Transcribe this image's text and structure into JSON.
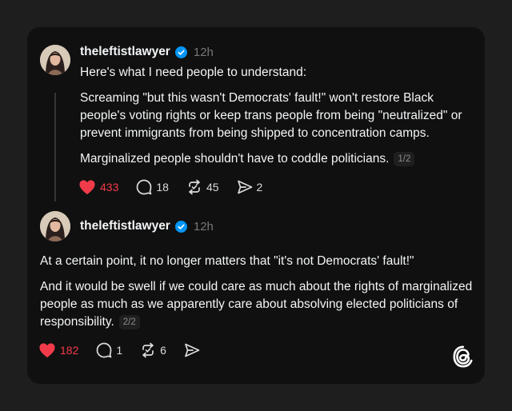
{
  "colors": {
    "background": "#1e1e1e",
    "card": "#101010",
    "like": "#f23b4a",
    "verified": "#0095f6",
    "muted": "#777777"
  },
  "posts": [
    {
      "username": "theleftistlawyer",
      "time": "12h",
      "verified_icon": "verified-badge-icon",
      "paragraphs": [
        "Here's what I need people to understand:",
        "Screaming \"but this wasn't Democrats' fault!\" won't restore Black people's voting rights or keep trans people from being \"neutralized\" or prevent immigrants from being shipped to concentration camps.",
        "Marginalized people shouldn't have to coddle politicians."
      ],
      "pager": "1/2",
      "likes": "433",
      "replies": "18",
      "reposts": "45",
      "shares": "2"
    },
    {
      "username": "theleftistlawyer",
      "time": "12h",
      "verified_icon": "verified-badge-icon",
      "paragraphs": [
        "At a certain point, it no longer matters that \"it's not Democrats' fault!\"",
        "And it would be swell if we could care as much about the rights of marginalized people as much as we apparently care about absolving elected politicians of responsibility."
      ],
      "pager": "2/2",
      "likes": "182",
      "replies": "1",
      "reposts": "6"
    }
  ],
  "brand_icon": "threads-logo-icon"
}
